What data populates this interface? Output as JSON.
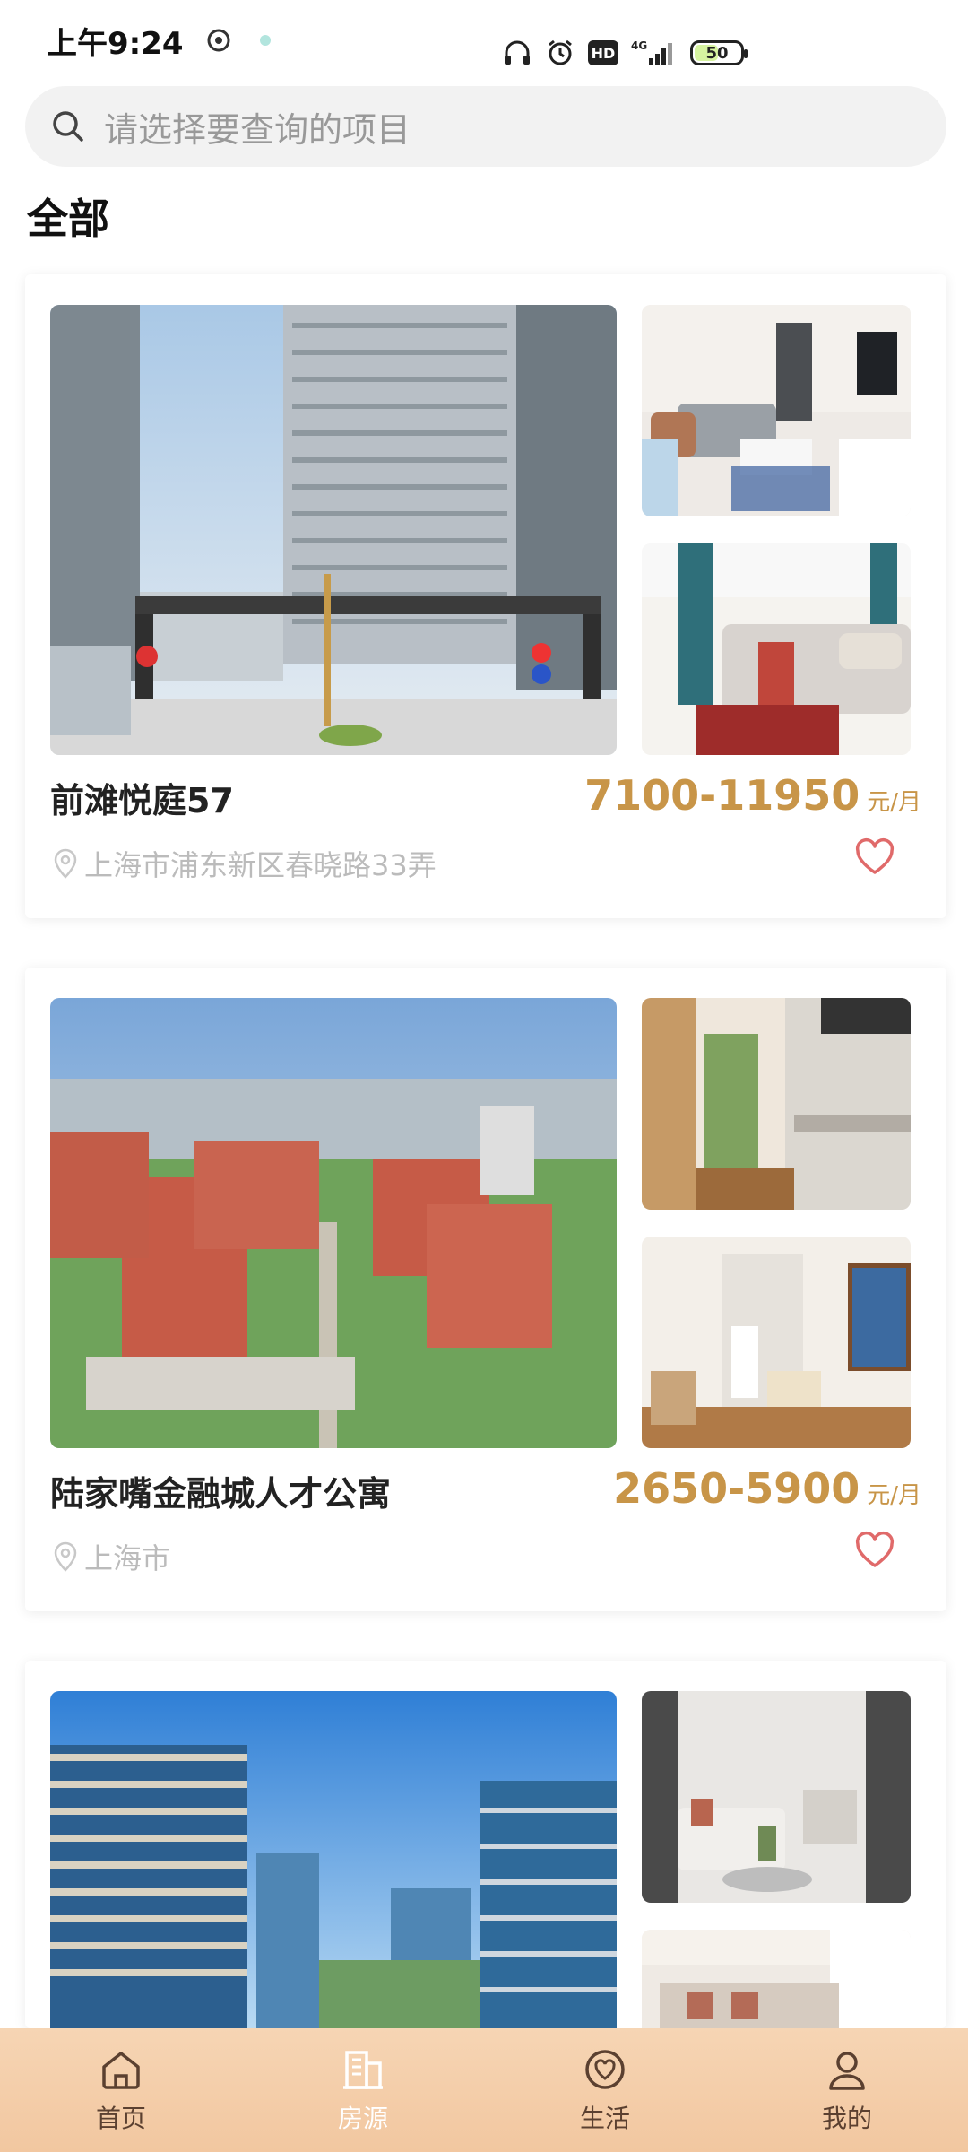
{
  "status_bar": {
    "time": "上午9:24",
    "network": "4G",
    "battery": "50"
  },
  "search": {
    "placeholder": "请选择要查询的项目"
  },
  "section": {
    "title": "全部"
  },
  "listings": [
    {
      "name": "前滩悦庭57",
      "price": "7100-11950",
      "price_unit": "元/月",
      "address": "上海市浦东新区春晓路33弄"
    },
    {
      "name": "陆家嘴金融城人才公寓",
      "price": "2650-5900",
      "price_unit": "元/月",
      "address": "上海市"
    },
    {
      "name": "",
      "price": "",
      "price_unit": "",
      "address": ""
    }
  ],
  "tab_bar": {
    "items": [
      {
        "label": "首页",
        "icon": "home-icon",
        "active": false
      },
      {
        "label": "房源",
        "icon": "building-icon",
        "active": true
      },
      {
        "label": "生活",
        "icon": "heart-circle-icon",
        "active": false
      },
      {
        "label": "我的",
        "icon": "user-icon",
        "active": false
      }
    ]
  },
  "colors": {
    "accent": "#c89548",
    "tab_bar": "#f2c7a0",
    "heart": "#e06a6a"
  }
}
